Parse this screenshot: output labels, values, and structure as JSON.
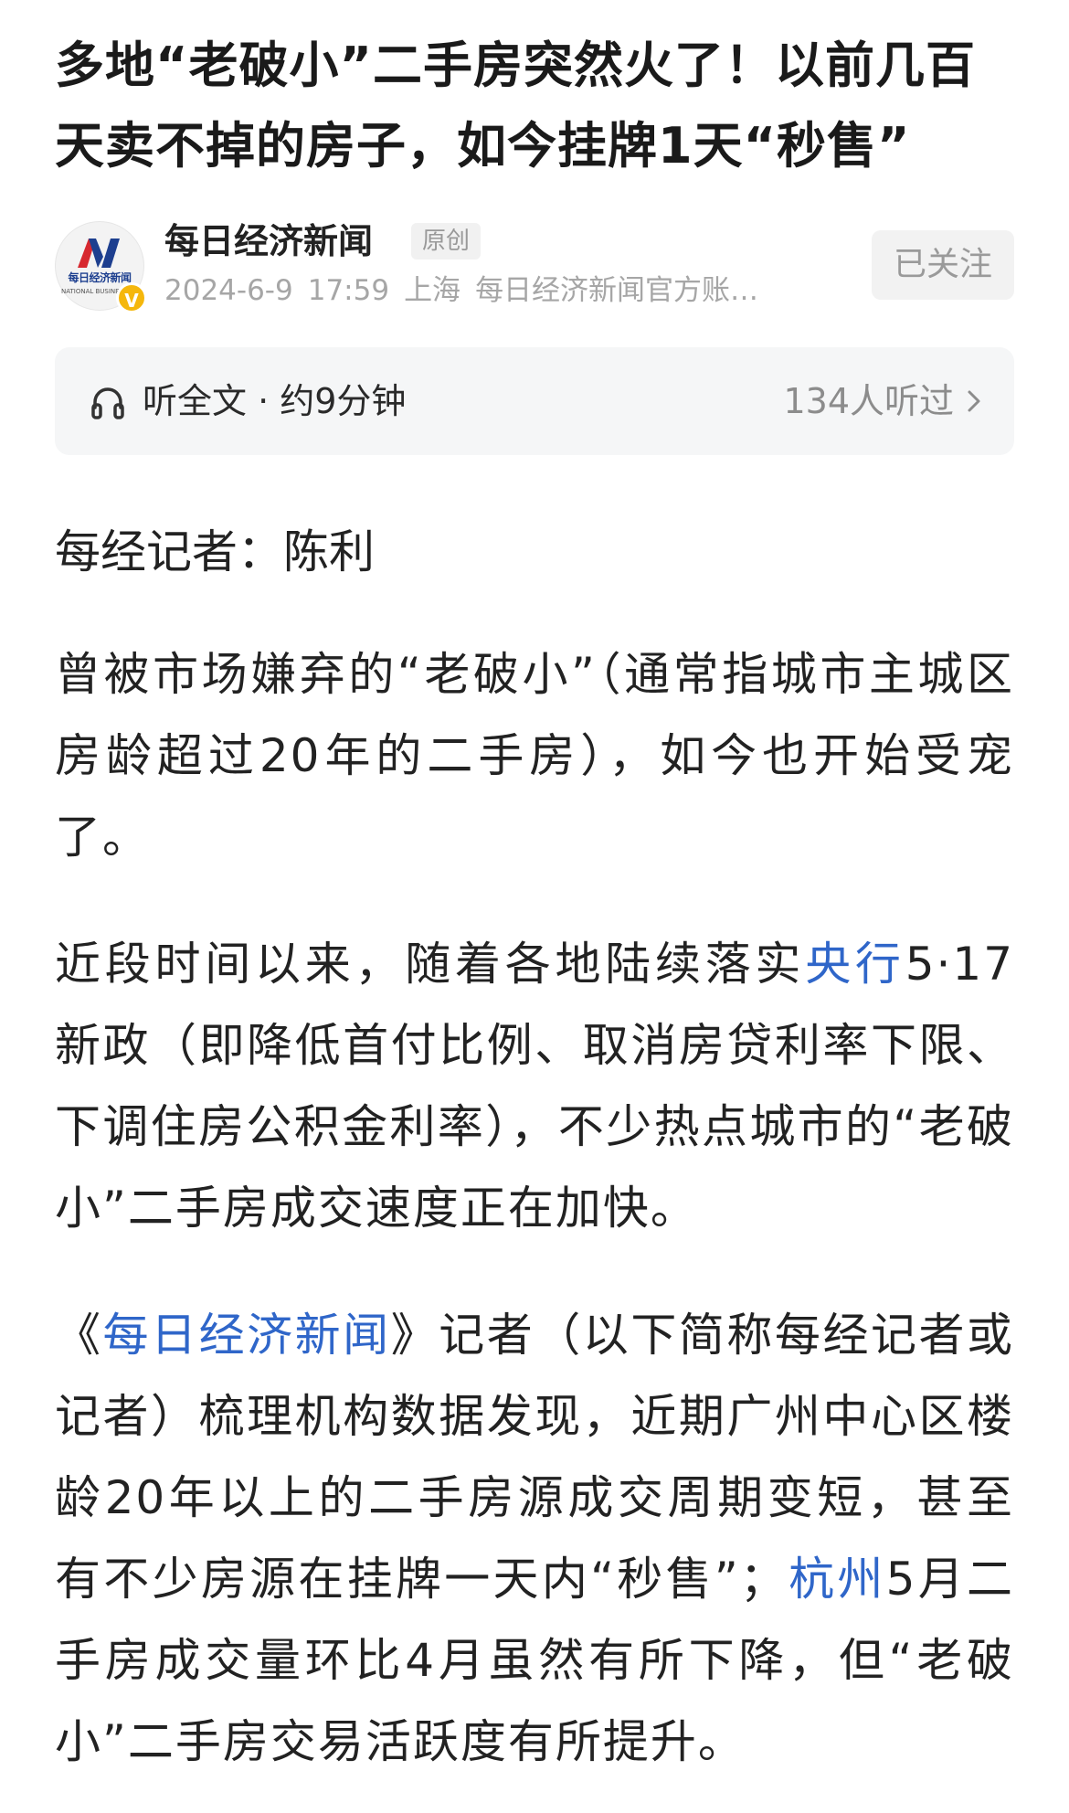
{
  "article": {
    "title": "多地“老破小”二手房突然火了！以前几百天卖不掉的房子，如今挂牌1天“秒售”"
  },
  "author": {
    "logo_text": "每日经济新闻",
    "logo_sub": "NATIONAL BUSINESS DAILY",
    "verify_mark": "V",
    "name": "每日经济新闻",
    "tag": "原创",
    "date": "2024-6-9",
    "time": "17:59",
    "location": "上海",
    "account": "每日经济新闻官方账…",
    "follow_label": "已关注"
  },
  "listen": {
    "label": "听全文 · 约9分钟",
    "count": "134人听过"
  },
  "body": {
    "byline": "每经记者：陈利",
    "p1": "曾被市场嫌弃的“老破小”（通常指城市主城区房龄超过20年的二手房），如今也开始受宠了。",
    "p2_a": "近段时间以来，随着各地陆续落实",
    "p2_link": "央行",
    "p2_b": "5·17新政（即降低首付比例、取消房贷利率下限、下调住房公积金利率），不少热点城市的“老破小”二手房成交速度正在加快。",
    "p3_a": "《",
    "p3_link1": "每日经济新闻",
    "p3_b": "》记者（以下简称每经记者或记者）梳理机构数据发现，近期广州中心区楼龄20年以上的二手房源成交周期变短，甚至有不少房源在挂牌一天内“秒售”；",
    "p3_link2": "杭州",
    "p3_c": "5月二手房成交量环比4月虽然有所下降，但“老破小”二手房交易活跃度有所提升。"
  },
  "colors": {
    "link": "#2f66c9",
    "verify": "#f5b70c",
    "logo_red": "#d7282f",
    "logo_blue": "#1d3f8f"
  },
  "icons": {
    "headphone": "headphone-icon",
    "chevron": "chevron-right-icon",
    "verified": "verified-badge-icon"
  }
}
